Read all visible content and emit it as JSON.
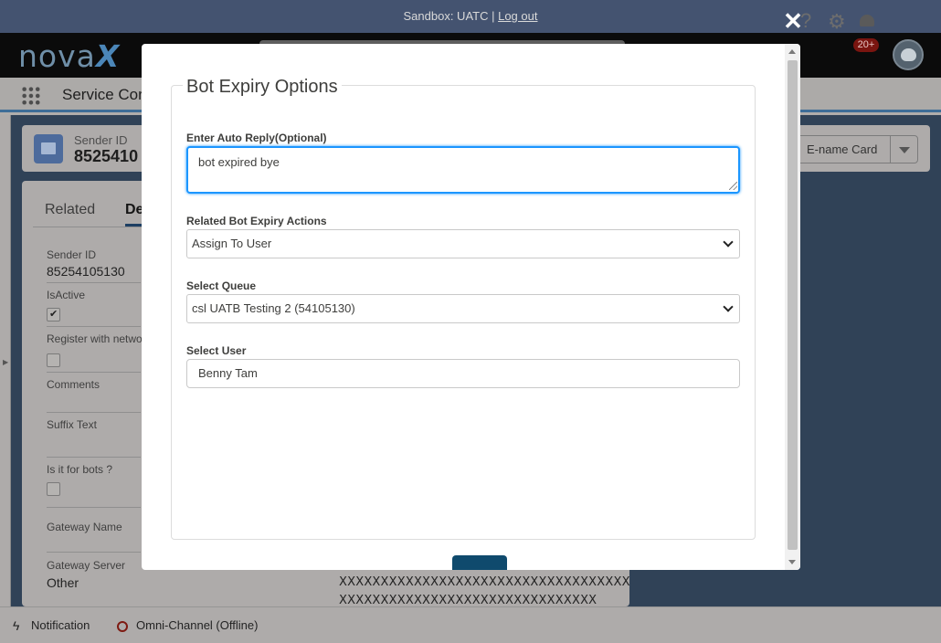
{
  "sandbox": {
    "text": "Sandbox: UATC | ",
    "logout": "Log out"
  },
  "header": {
    "logo_main": "nova",
    "logo_accent": "X",
    "notif_count": "20+"
  },
  "nav": {
    "app_name": "Service Cor"
  },
  "record": {
    "label": "Sender ID",
    "value": "85254105130",
    "value_truncated": "8525410",
    "action_label": "E-name Card"
  },
  "tabs": {
    "related": "Related",
    "details": "De"
  },
  "fields": {
    "sender_id_label": "Sender ID",
    "sender_id_value": "85254105130",
    "isactive_label": "IsActive",
    "register_label": "Register with netwo",
    "comments_label": "Comments",
    "suffix_label": "Suffix Text",
    "bots_label": "Is it for bots ?",
    "gateway_name_label": "Gateway Name",
    "gateway_server_label": "Gateway Server",
    "gateway_server_value": "Other",
    "xx_line1": "XXXXXXXXXXXXXXXXXXXXXXXXXXXXXXXXXXX",
    "xx_line2": "XXXXXXXXXXXXXXXXXXXXXXXXXXXXXXX"
  },
  "utility": {
    "notification": "Notification",
    "omni": "Omni-Channel (Offline)"
  },
  "modal": {
    "close_glyph": "✕",
    "title": "Bot Expiry Options",
    "auto_reply_label": "Enter Auto Reply(Optional)",
    "auto_reply_value": "bot expired bye",
    "actions_label": "Related Bot Expiry Actions",
    "actions_value": "Assign To User",
    "queue_label": "Select Queue",
    "queue_value": "csl UATB Testing 2 (54105130)",
    "user_label": "Select User",
    "user_value": "Benny Tam"
  }
}
